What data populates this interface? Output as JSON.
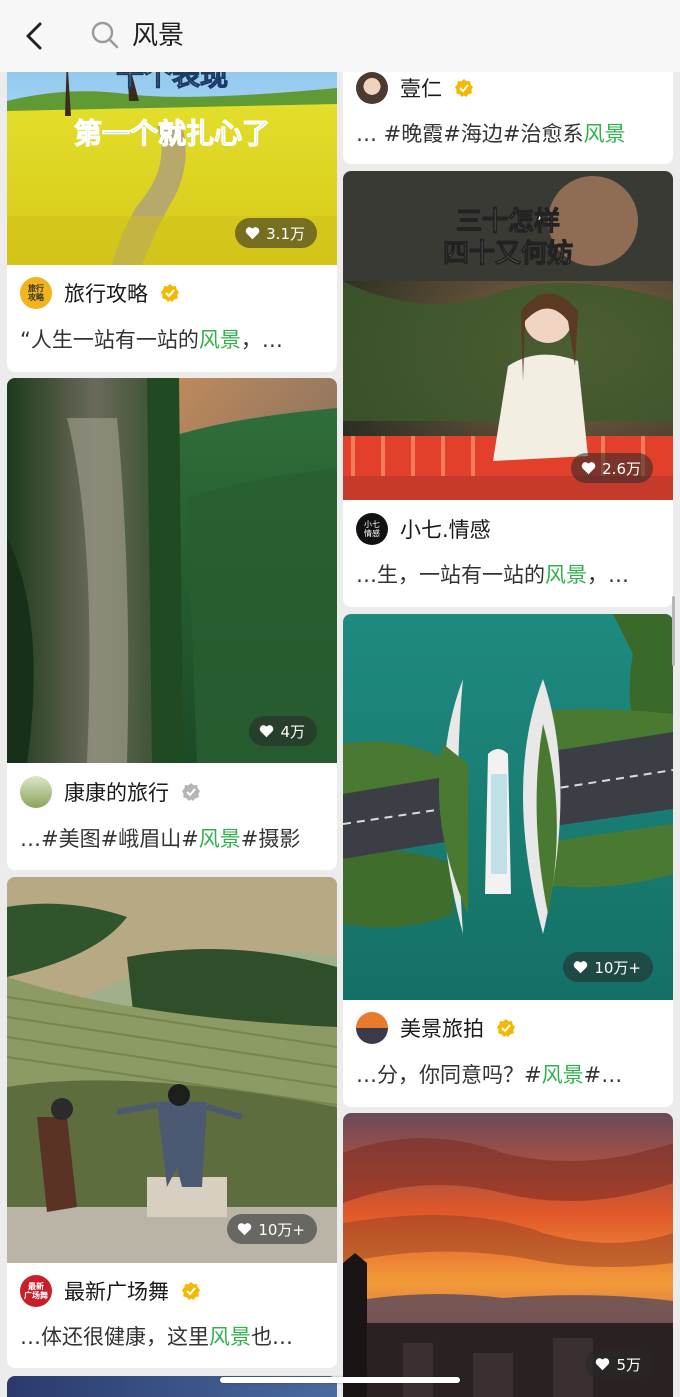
{
  "header": {
    "back_icon": "chevron-left-icon",
    "search_icon": "search-icon",
    "query": "风景"
  },
  "colors": {
    "keyword": "#2fb24c",
    "verified": "#f5b800"
  },
  "left_column": [
    {
      "overlay_text_1": "十个表现",
      "overlay_text_2": "第一个就扎心了",
      "likes": "3.1万",
      "avatar_text": "旅行\n攻略",
      "author": "旅行攻略",
      "verified": true,
      "desc_before": "“人生一站有一站的",
      "desc_keyword": "风景",
      "desc_after": "，…"
    },
    {
      "likes": "4万",
      "author": "康康的旅行",
      "verified": true,
      "desc_before": "…#美图#峨眉山#",
      "desc_keyword": "风景",
      "desc_after": "#摄影"
    },
    {
      "likes": "10万+",
      "avatar_text": "最新\n广场舞",
      "author": "最新广场舞",
      "verified": true,
      "desc_before": "…体还很健康，这里",
      "desc_keyword": "风景",
      "desc_after": "也…"
    }
  ],
  "right_column": [
    {
      "author": "壹仁",
      "verified": true,
      "desc_before": "… #晚霞#海边#治愈系",
      "desc_keyword": "风景",
      "desc_after": ""
    },
    {
      "overlay_text_1": "三十怎样",
      "overlay_text_2": "四十又何妨",
      "likes": "2.6万",
      "avatar_text": "小七\n情感",
      "author": "小七.情感",
      "verified": false,
      "desc_before": "…生，一站有一站的",
      "desc_keyword": "风景",
      "desc_after": "，…"
    },
    {
      "likes": "10万+",
      "author": "美景旅拍",
      "verified": true,
      "desc_before": "…分，你同意吗？#",
      "desc_keyword": "风景",
      "desc_after": "#…"
    },
    {
      "likes": "5万"
    }
  ]
}
